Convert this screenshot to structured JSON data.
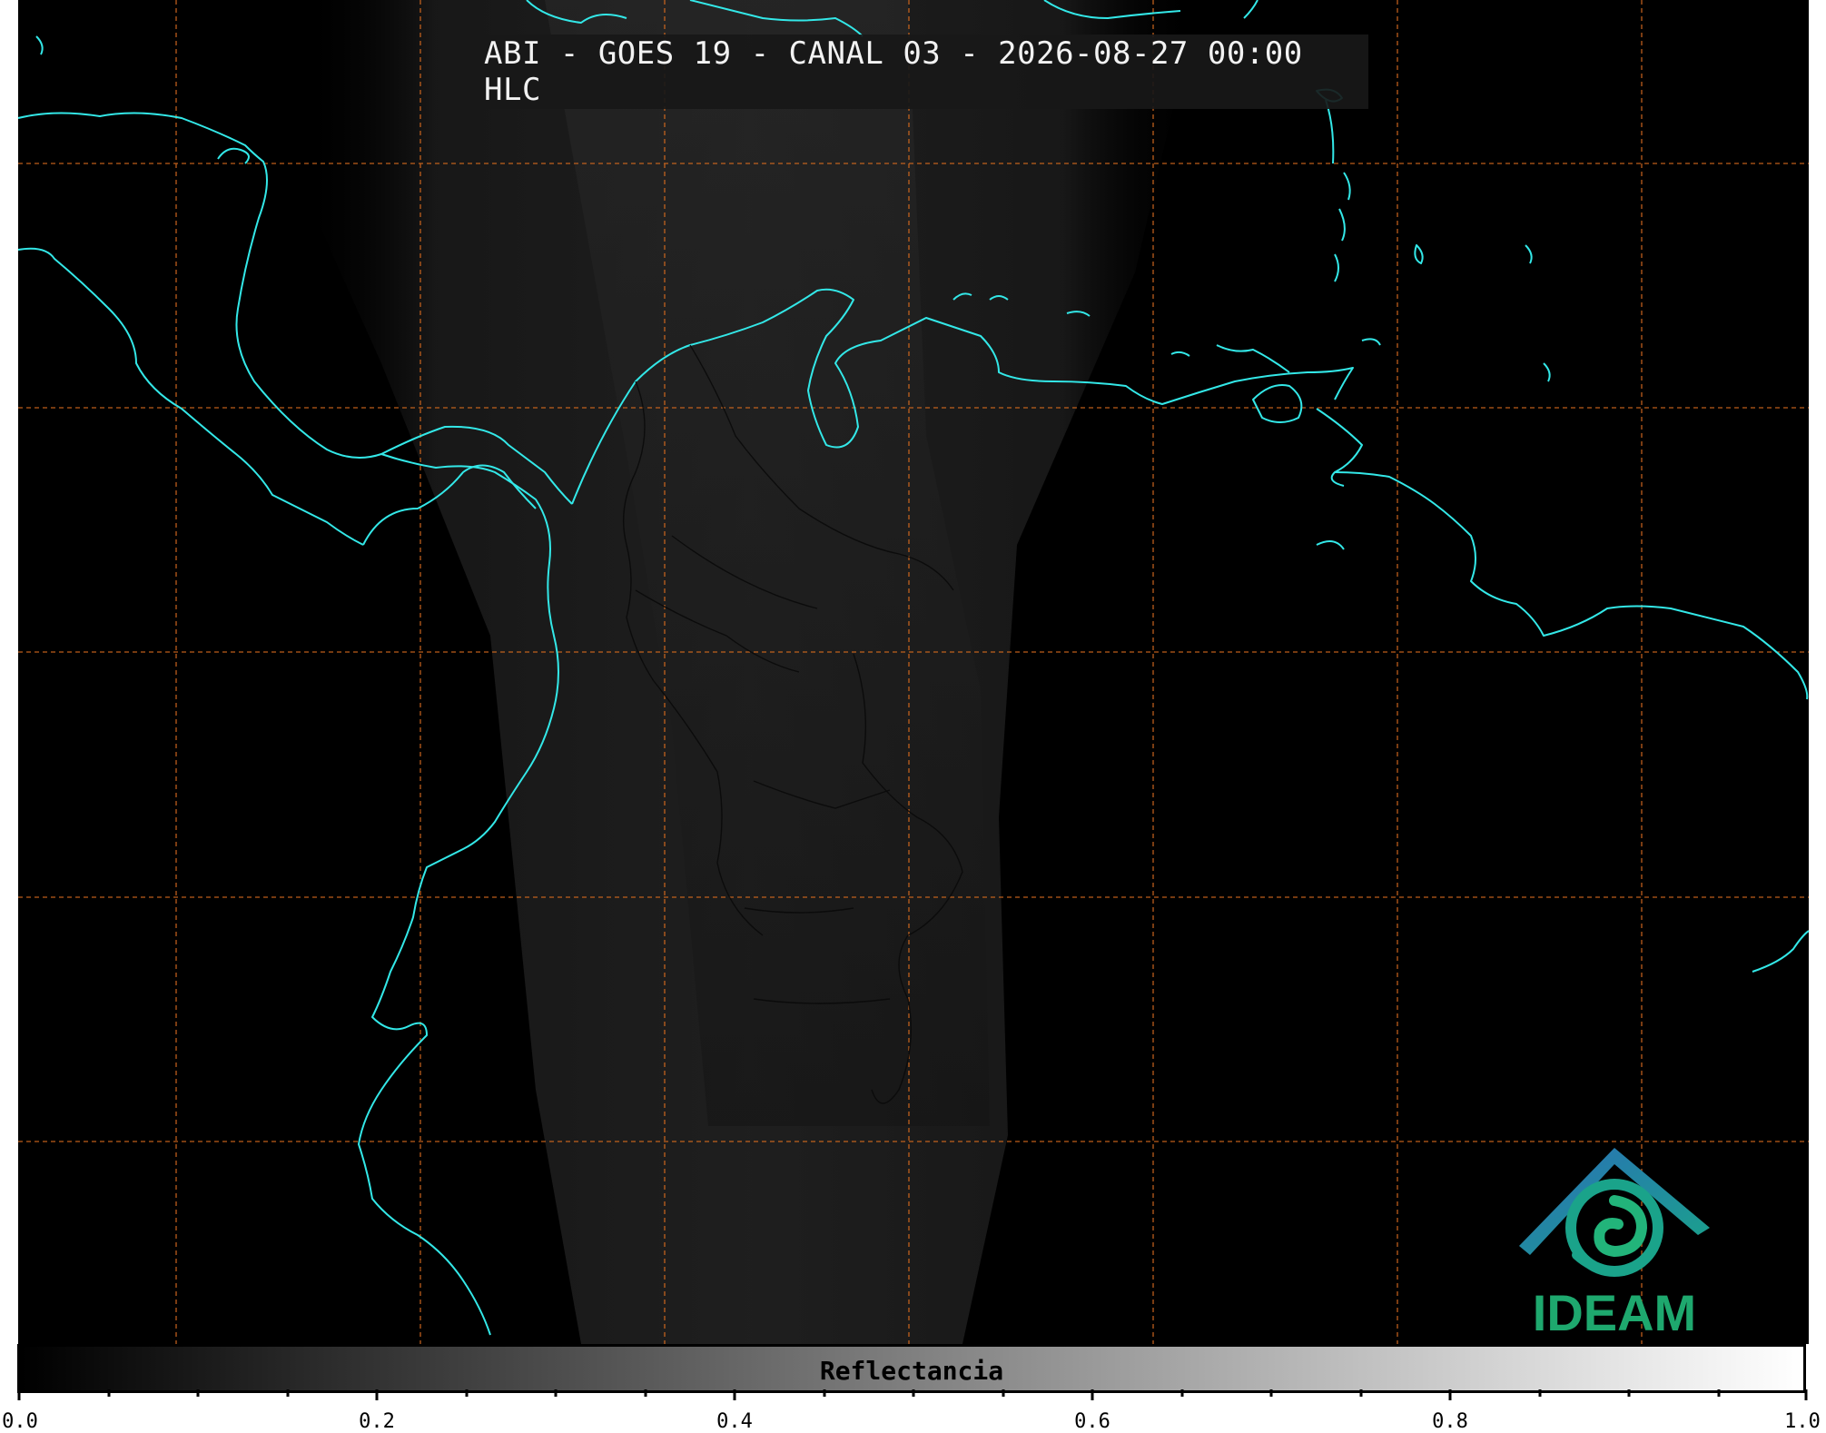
{
  "title": "ABI - GOES 19 - CANAL 03 - 2026-08-27 00:00 HLC",
  "logo": {
    "text": "IDEAM",
    "text_color": "#1ea86e",
    "emblem_colors": [
      "#2a6fb8",
      "#1aa38a",
      "#22b47a"
    ]
  },
  "colorbar": {
    "label": "Reflectancia",
    "ticks": [
      "0.0",
      "0.2",
      "0.4",
      "0.6",
      "0.8",
      "1.0"
    ],
    "colormap": [
      "#000000",
      "#ffffff"
    ]
  },
  "map": {
    "background": "#000000",
    "coastline_color": "#33e8e8",
    "grid_color": "#d2691e",
    "grid_style": "dashed"
  }
}
